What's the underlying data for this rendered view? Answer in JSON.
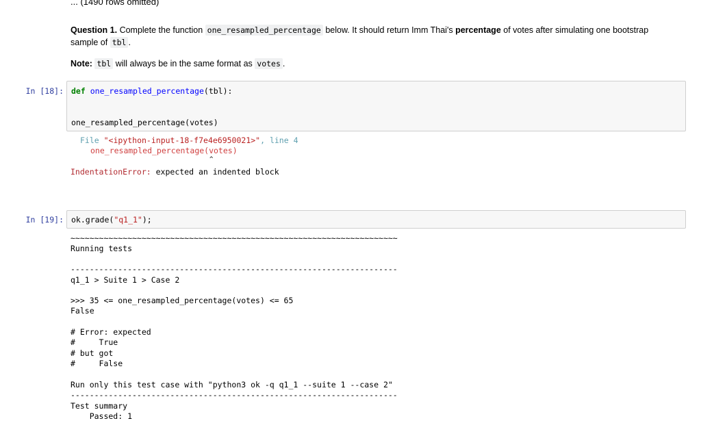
{
  "omitted_rows": "... (1490 rows omitted)",
  "question": {
    "label": "Question 1.",
    "p1_a": "Complete the function",
    "func_name": "one_resampled_percentage",
    "p1_b": "below. It should return Imm Thai's",
    "percentage_word": "percentage",
    "p1_c": "of votes after simulating one bootstrap",
    "p1_d": "sample of",
    "tbl": "tbl",
    "p1_e": ".",
    "note_label": "Note:",
    "note_tbl": "tbl",
    "note_text": "will always be in the same format as",
    "note_votes": "votes",
    "note_end": "."
  },
  "cell18": {
    "prompt": "In [18]:",
    "def_kw": "def",
    "def_name": "one_resampled_percentage",
    "def_rest": "(tbl):",
    "call_line": "one_resampled_percentage(votes)",
    "traceback_file": "File ",
    "traceback_str": "\"<ipython-input-18-f7e4e6950021>\"",
    "traceback_line": ", line 4",
    "traceback_code": "one_resampled_percentage(votes)",
    "caret": "^",
    "error_name": "IndentationError:",
    "error_msg": " expected an indented block"
  },
  "cell19": {
    "prompt": "In [19]:",
    "code_a": "ok.grade(",
    "code_str": "\"q1_1\"",
    "code_b": ");",
    "output": {
      "tilde_line": "~~~~~~~~~~~~~~~~~~~~~~~~~~~~~~~~~~~~~~~~~~~~~~~~~~~~~~~~~~~~~~~~~~~~~",
      "running": "Running tests",
      "dash_line": "---------------------------------------------------------------------",
      "case_path": "q1_1 > Suite 1 > Case 2",
      "test_expr": ">>> 35 <= one_resampled_percentage(votes) <= 65",
      "result": "False",
      "err1": "# Error: expected",
      "err2": "#     True",
      "err3": "# but got",
      "err4": "#     False",
      "run_only": "Run only this test case with \"python3 ok -q q1_1 --suite 1 --case 2\"",
      "dash_line2": "---------------------------------------------------------------------",
      "summary": "Test summary",
      "passed": "    Passed: 1"
    }
  }
}
